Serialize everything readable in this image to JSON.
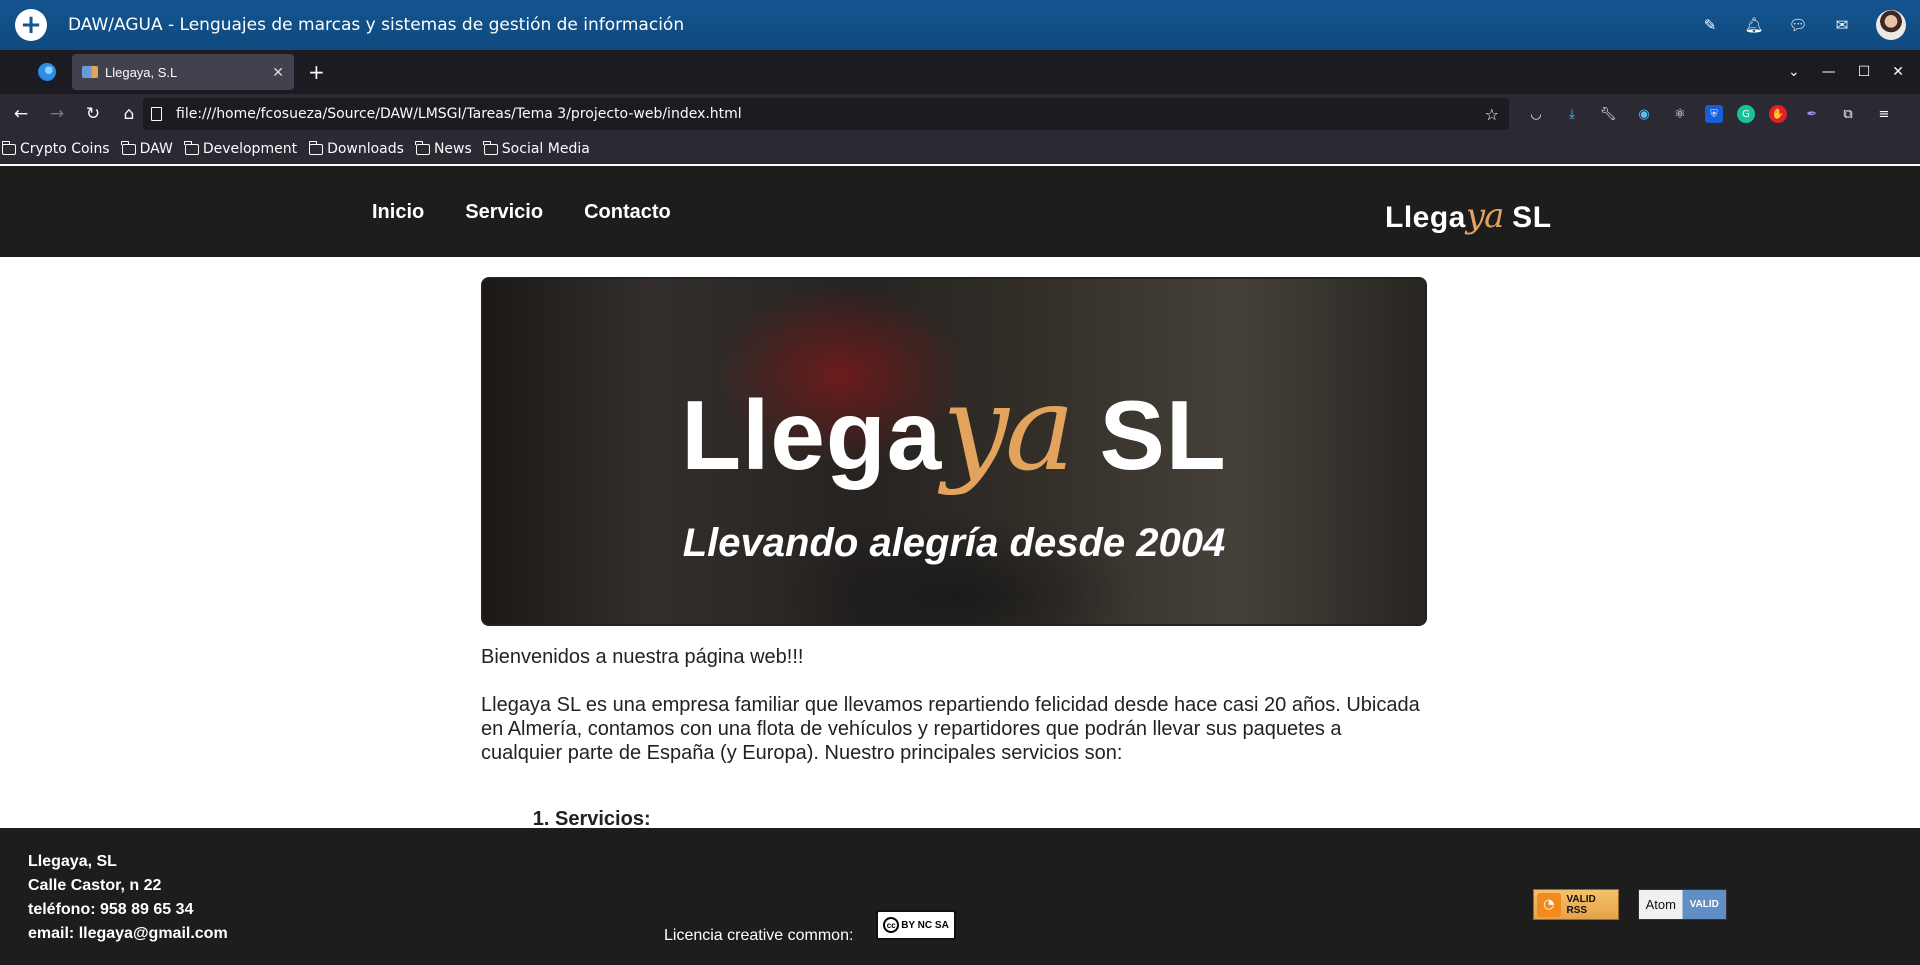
{
  "appbar": {
    "title": "DAW/AGUA - Lenguajes de marcas y sistemas de gestión de información"
  },
  "browser": {
    "tab_title": "Llegaya, S.L",
    "url": "file:///home/fcosueza/Source/DAW/LMSGI/Tareas/Tema 3/projecto-web/index.html",
    "bookmarks": [
      "Crypto Coins",
      "DAW",
      "Development",
      "Downloads",
      "News",
      "Social Media"
    ]
  },
  "site": {
    "nav": [
      "Inicio",
      "Servicio",
      "Contacto"
    ],
    "logo": {
      "pre": "Llega",
      "ya": "ya",
      "post": " SL"
    },
    "hero": {
      "title_pre": "Llega",
      "title_ya": "ya",
      "title_post": " SL",
      "subtitle": "Llevando alegría desde 2004"
    },
    "welcome": "Bienvenidos a nuestra página web!!!",
    "intro": "Llegaya SL es una empresa familiar que llevamos repartiendo felicidad desde hace casi 20 años. Ubicada en Almería, contamos con una flota de vehículos y repartidores que podrán llevar sus paquetes a cualquier parte de España (y Europa). Nuestro principales servicios son:",
    "list_item_1": "Servicios:"
  },
  "footer": {
    "company": "Llegaya, SL",
    "address": "Calle Castor, n 22",
    "phone": "teléfono: 958 89 65 34",
    "email": "email: llegaya@gmail.com",
    "license_label": "Licencia creative common:",
    "cc_text": "BY NC SA",
    "rss_badge": "VALID RSS",
    "atom_badge_left": "Atom",
    "atom_badge_right": "VALID"
  }
}
